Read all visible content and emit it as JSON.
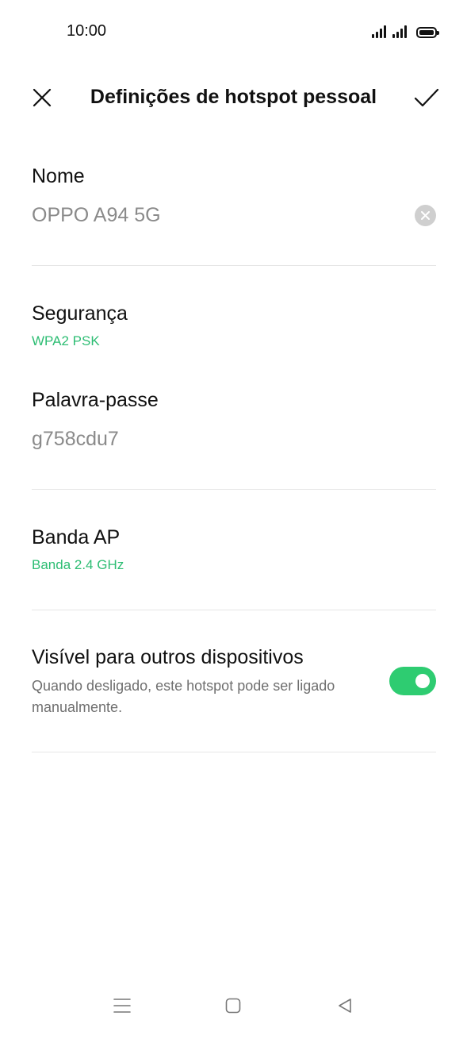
{
  "status_bar": {
    "time": "10:00",
    "icons": [
      "signal-icon",
      "signal-icon",
      "battery-icon"
    ]
  },
  "header": {
    "title": "Definições de hotspot pessoal",
    "close_icon": "close-icon",
    "confirm_icon": "checkmark-icon"
  },
  "fields": {
    "name": {
      "label": "Nome",
      "value": "OPPO A94 5G",
      "clear_icon": "clear-icon"
    },
    "security": {
      "label": "Segurança",
      "value": "WPA2 PSK"
    },
    "password": {
      "label": "Palavra-passe",
      "value": "g758cdu7"
    },
    "band": {
      "label": "Banda AP",
      "value": "Banda 2.4 GHz"
    },
    "visible": {
      "label": "Visível para outros dispositivos",
      "description": "Quando desligado, este hotspot pode ser ligado manualmente.",
      "enabled": true
    }
  },
  "nav_bar": {
    "icons": [
      "menu-icon",
      "home-icon",
      "back-icon"
    ]
  },
  "colors": {
    "accent": "#2dbd73",
    "toggle_on": "#2ecc71",
    "text_primary": "#111111",
    "text_secondary": "#8a8a8a",
    "divider": "#e6e6e6"
  }
}
